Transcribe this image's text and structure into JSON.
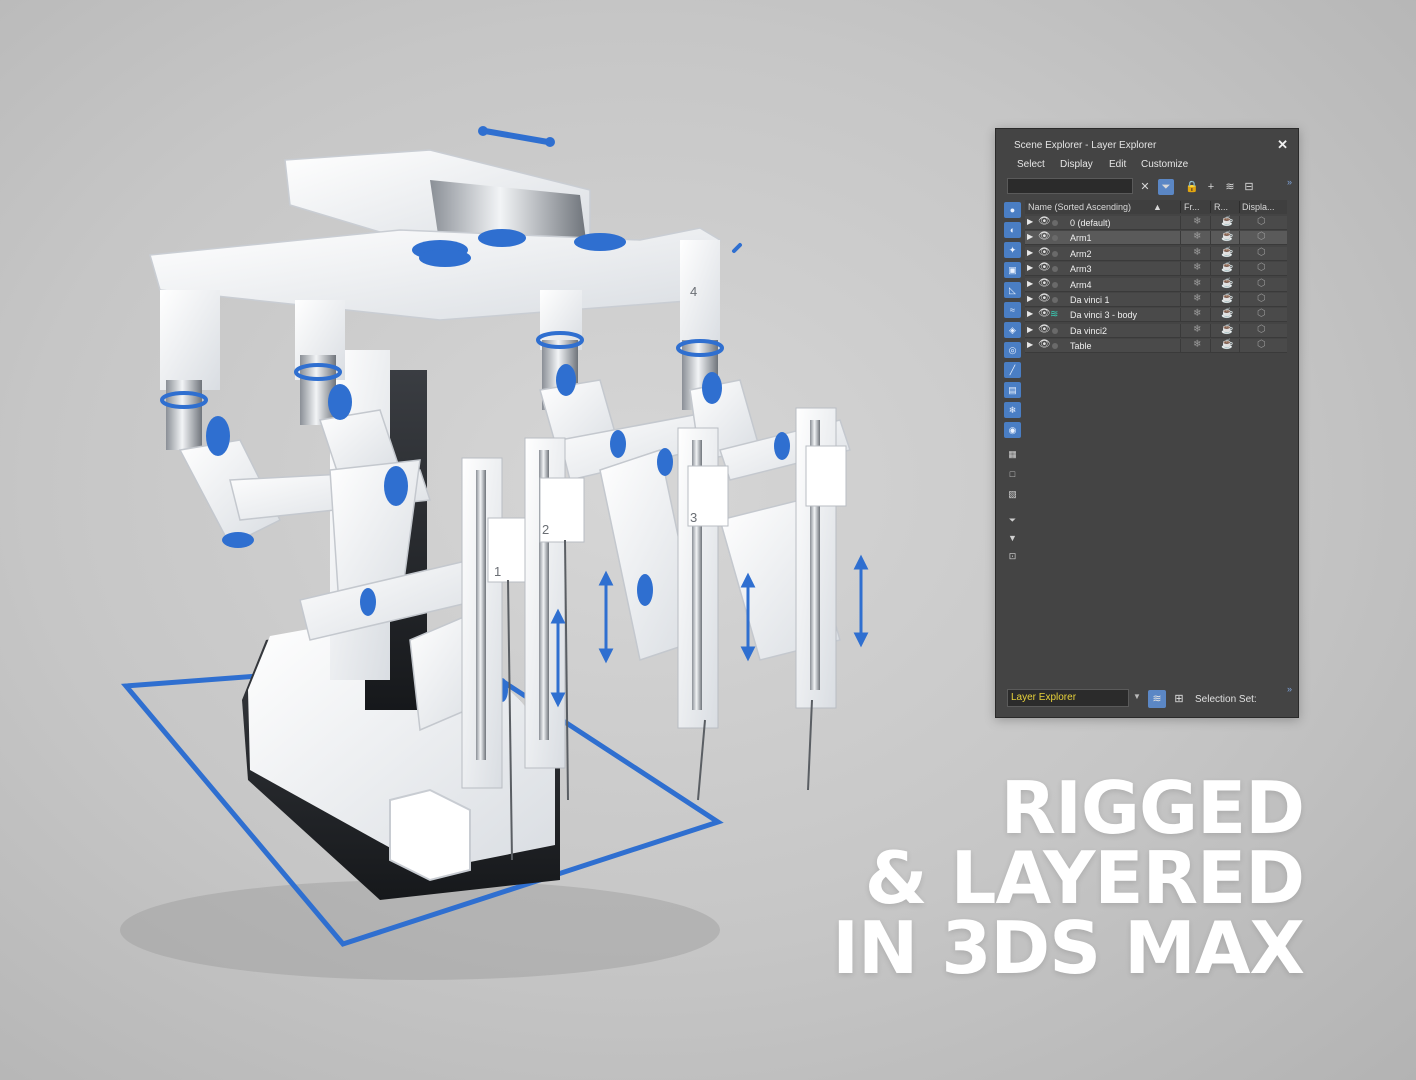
{
  "explorer": {
    "title": "Scene Explorer - Layer Explorer",
    "menu": [
      "Select",
      "Display",
      "Edit",
      "Customize"
    ],
    "search_placeholder": "",
    "columns": {
      "name": "Name (Sorted Ascending)",
      "frozen": "Fr...",
      "render": "R...",
      "display": "Displa..."
    },
    "rows": [
      {
        "name": "0 (default)",
        "selected": false
      },
      {
        "name": "Arm1",
        "selected": true
      },
      {
        "name": "Arm2",
        "selected": false
      },
      {
        "name": "Arm3",
        "selected": false
      },
      {
        "name": "Arm4",
        "selected": false
      },
      {
        "name": "Da vinci 1",
        "selected": false
      },
      {
        "name": "Da vinci 3 - body",
        "selected": false
      },
      {
        "name": "Da vinci2",
        "selected": false
      },
      {
        "name": "Table",
        "selected": false
      }
    ],
    "layer_dropdown": "Layer Explorer",
    "selection_set_label": "Selection Set:"
  },
  "headline": [
    "RIGGED",
    "& LAYERED",
    "IN 3DS MAX"
  ],
  "arm_numbers": [
    "1",
    "2",
    "3",
    "4"
  ],
  "colors": {
    "accent_blue": "#2f6fd0",
    "panel_bg": "#444444",
    "dropdown_text": "#e8d23a",
    "headline": "#ffffff"
  }
}
